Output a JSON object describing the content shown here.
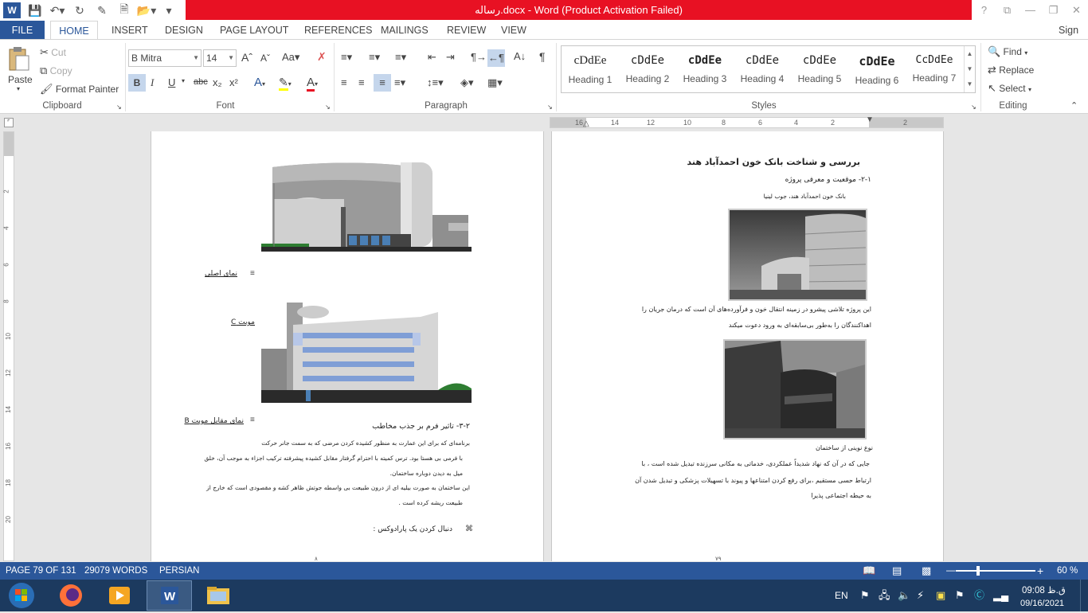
{
  "window": {
    "title": "رساله.docx -  Word (Product Activation Failed)",
    "controls": [
      "?",
      "⧉",
      "—",
      "❐",
      "✕"
    ]
  },
  "tabs": [
    "FILE",
    "HOME",
    "INSERT",
    "DESIGN",
    "PAGE LAYOUT",
    "REFERENCES",
    "MAILINGS",
    "REVIEW",
    "VIEW"
  ],
  "sign_in": "Sign in",
  "clipboard": {
    "paste": "Paste",
    "cut": "Cut",
    "copy": "Copy",
    "format_painter": "Format Painter",
    "label": "Clipboard"
  },
  "font": {
    "name": "B Mitra",
    "size": "14",
    "label": "Font",
    "bold": "B",
    "italic": "I",
    "underline": "U",
    "strike": "abc",
    "sub": "x₂",
    "sup": "x²"
  },
  "paragraph": {
    "label": "Paragraph"
  },
  "styles": {
    "label": "Styles",
    "items": [
      {
        "preview": "cDdEe",
        "name": "Heading 1"
      },
      {
        "preview": "cDdEe",
        "name": "Heading 2"
      },
      {
        "preview": "cDdEe",
        "name": "Heading 3"
      },
      {
        "preview": "cDdEe",
        "name": "Heading 4"
      },
      {
        "preview": "cDdEe",
        "name": "Heading 5"
      },
      {
        "preview": "cDdEe",
        "name": "Heading 6"
      },
      {
        "preview": "CcDdEe",
        "name": "Heading 7"
      }
    ]
  },
  "editing": {
    "find": "Find",
    "replace": "Replace",
    "select": "Select",
    "label": "Editing"
  },
  "ruler": {
    "h_numbers": [
      "16",
      "14",
      "12",
      "10",
      "8",
      "6",
      "4",
      "2",
      "2"
    ],
    "v_numbers": [
      "2",
      "4",
      "6",
      "8",
      "10",
      "12",
      "14",
      "16",
      "18",
      "20"
    ]
  },
  "page_left": {
    "caption_main": "نمای اصلی",
    "caption_c": "موبت C",
    "caption_b": "نمای مقابل موبت B",
    "heading": "۳-۲-  تاثیر فرم بر جذب مخاطب",
    "lines": [
      "برنامه‌ای که برای این عمارت به منظور کشیده کردن مرضی که به سمت جانر حرکت",
      "با فرمی بی هستا بود. ترس کمیته با احترام گرفتار مقابل کشیده پیشرفته ترکیب اجزاء به موجب آن، خلق",
      "میل به دیدن دوباره ساختمان.",
      "این ساختمان به صورت بیلیه ای از درون طبیعت بی واسطه جوتش ظاهر کشه و مقصودی است که خارج از",
      "طبیعت ریشه کرده است ."
    ],
    "last_line": "دنبال کردن یک پارادوکس :",
    "page_no": "۸"
  },
  "page_right": {
    "title": "بررسی و شناخت بانک خون احمدآباد هند",
    "subtitle": "۲-۱-   موقعیت و معرفی پروژه",
    "caption1": "بانک خون احمدآباد هند، جوب لینیا",
    "para1": [
      "این پروژه تلاشی پیشرو در زمینه انتقال خون و فرآورده‌های آن است که درمان جریان را",
      "اهداکنندگان را به‌طور بی‌سابقه‌ای به ورود دعوت میکند"
    ],
    "caption2": "نوع نوینی از ساختمان",
    "para2": [
      "جایی که در آن که نهاد شدیداً عملکردی، خدماتی به مکانی سرزنده تبدیل شده است ، با",
      "ارتباط حسی مستقیم ،برای رفع کردن امتناعها و پیوند با تسهیلات پزشکی و تبدیل شدن آن",
      "به حیطه اجتماعی پذیرا"
    ],
    "page_no": "۷۹"
  },
  "status": {
    "page": "PAGE 79 OF 131",
    "words": "29079 WORDS",
    "lang": "PERSIAN",
    "zoom": "60 %"
  },
  "taskbar": {
    "lang": "EN",
    "time": "09:08 ق.ظ",
    "date": "09/16/2021"
  },
  "colors": {
    "accent": "#2b579a",
    "title_red": "#e81123"
  }
}
